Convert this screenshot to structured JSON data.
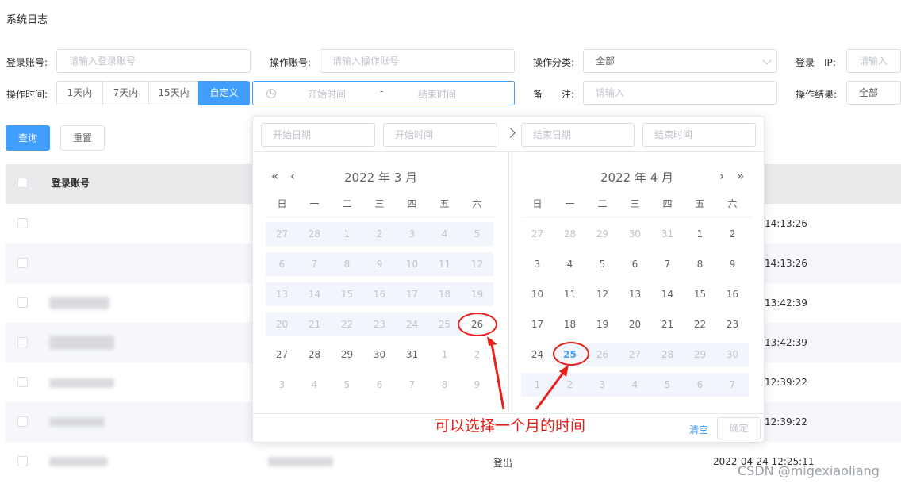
{
  "page": {
    "title": "系统日志"
  },
  "filters": {
    "login_account": {
      "label": "登录账号:",
      "placeholder": "请输入登录账号"
    },
    "op_account": {
      "label": "操作账号:",
      "placeholder": "请输入操作账号"
    },
    "op_category": {
      "label": "操作分类:",
      "value": "全部"
    },
    "login_ip": {
      "label": "登录　IP:",
      "placeholder": "请输入"
    },
    "op_time": {
      "label": "操作时间:",
      "segments": [
        "1天内",
        "7天内",
        "15天内",
        "自定义"
      ],
      "active": 3
    },
    "range": {
      "start_placeholder": "开始时间",
      "separator": "-",
      "end_placeholder": "结束时间"
    },
    "remark": {
      "label": "备　　注:",
      "placeholder": "请输入"
    },
    "op_result": {
      "label": "操作结果:",
      "value": "全部"
    }
  },
  "actions": {
    "query": "查询",
    "reset": "重置"
  },
  "table": {
    "header": {
      "login_account": "登录账号"
    },
    "times": [
      "14:13:26",
      "14:13:26",
      "13:42:39",
      "13:42:39",
      "12:39:22",
      "12:39:22",
      "2022-04-24 12:25:11"
    ],
    "last_row_op": "登出"
  },
  "picker": {
    "start_date_ph": "开始日期",
    "start_time_ph": "开始时间",
    "end_date_ph": "结束日期",
    "end_time_ph": "结束时间",
    "weekdays": [
      "日",
      "一",
      "二",
      "三",
      "四",
      "五",
      "六"
    ],
    "left": {
      "title": "2022 年 3 月",
      "nav_prev_year": "«",
      "nav_prev_month": "‹",
      "days": [
        [
          "27",
          "28",
          "1",
          "2",
          "3",
          "4",
          "5"
        ],
        [
          "6",
          "7",
          "8",
          "9",
          "10",
          "11",
          "12"
        ],
        [
          "13",
          "14",
          "15",
          "16",
          "17",
          "18",
          "19"
        ],
        [
          "20",
          "21",
          "22",
          "23",
          "24",
          "25",
          "26"
        ],
        [
          "27",
          "28",
          "29",
          "30",
          "31",
          "1",
          "2"
        ],
        [
          "3",
          "4",
          "5",
          "6",
          "7",
          "8",
          "9"
        ]
      ]
    },
    "right": {
      "title": "2022 年 4 月",
      "nav_next_month": "›",
      "nav_next_year": "»",
      "days": [
        [
          "27",
          "28",
          "29",
          "30",
          "31",
          "1",
          "2"
        ],
        [
          "3",
          "4",
          "5",
          "6",
          "7",
          "8",
          "9"
        ],
        [
          "10",
          "11",
          "12",
          "13",
          "14",
          "15",
          "16"
        ],
        [
          "17",
          "18",
          "19",
          "20",
          "21",
          "22",
          "23"
        ],
        [
          "24",
          "25",
          "26",
          "27",
          "28",
          "29",
          "30"
        ],
        [
          "1",
          "2",
          "3",
          "4",
          "5",
          "6",
          "7"
        ]
      ]
    },
    "clear": "清空",
    "confirm": "确定"
  },
  "annotation": "可以选择一个月的时间",
  "watermark": "CSDN @migexiaoliang",
  "colors": {
    "primary": "#409eff",
    "annotation": "#e8201a"
  }
}
